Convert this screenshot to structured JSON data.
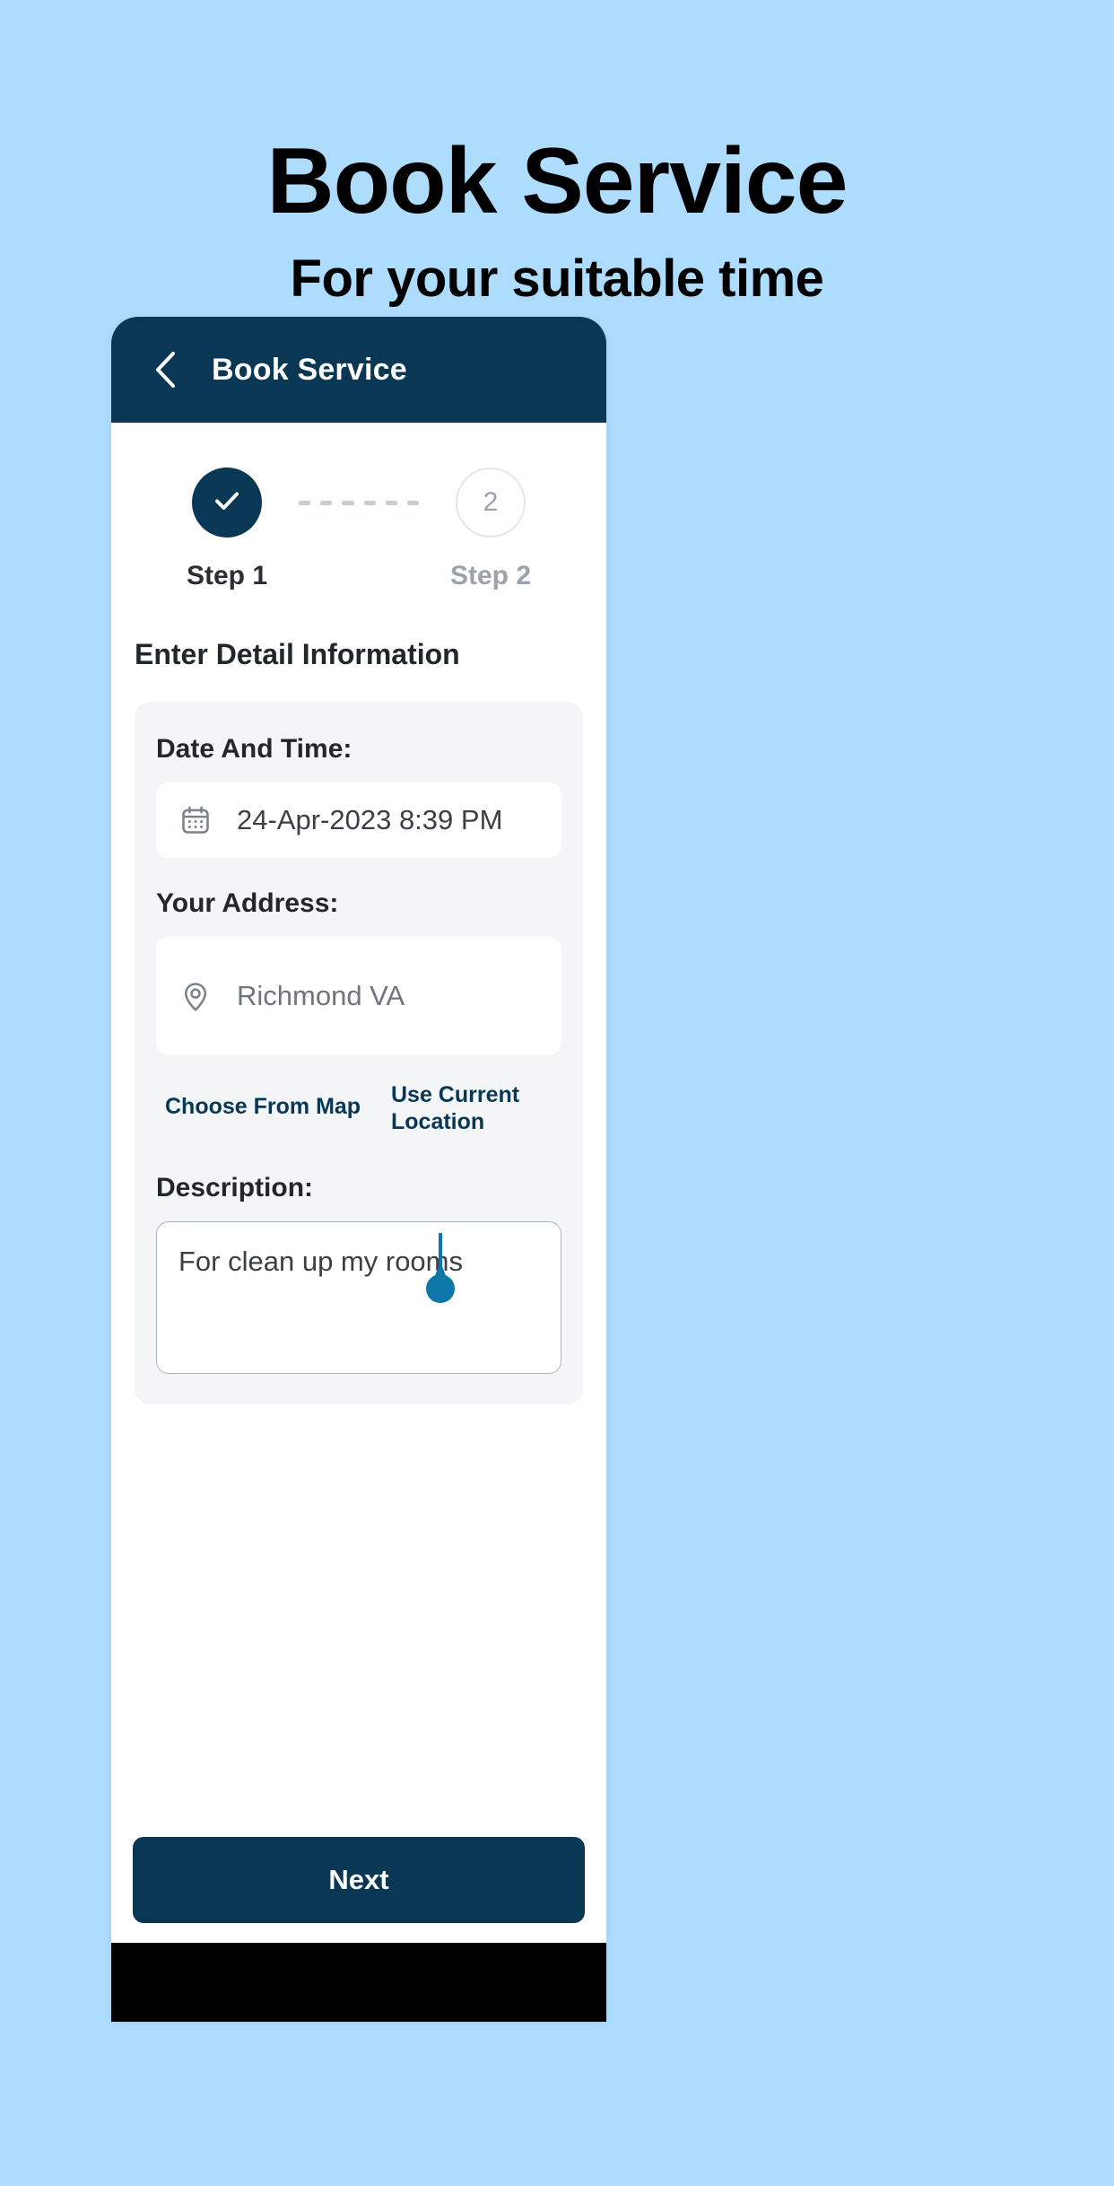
{
  "promo": {
    "title": "Book Service",
    "subtitle": "For your suitable time"
  },
  "appbar": {
    "title": "Book Service",
    "back_icon": "chevron-left-icon",
    "background": "#0A3754"
  },
  "stepper": {
    "steps": [
      {
        "label": "Step 1",
        "state": "completed",
        "glyph": "check-icon"
      },
      {
        "label": "Step 2",
        "state": "upcoming",
        "glyph": "2"
      }
    ],
    "connector_dashes": 6
  },
  "form": {
    "section_title": "Enter Detail Information",
    "date_time": {
      "label": "Date And Time:",
      "icon": "calendar-icon",
      "value": "24-Apr-2023 8:39 PM"
    },
    "address": {
      "label": "Your Address:",
      "icon": "location-pin-icon",
      "value": "Richmond VA",
      "placeholder": "Richmond VA"
    },
    "links": {
      "choose_from_map": "Choose From Map",
      "use_current_location": "Use Current Location"
    },
    "description": {
      "label": "Description:",
      "value": "For clean up my rooms"
    }
  },
  "actions": {
    "next_label": "Next"
  },
  "colors": {
    "page_background": "#ADDCFC",
    "brand_navy": "#0A3754",
    "card_gray": "#F3F5F6",
    "cursor_blue": "#0C77A8"
  }
}
